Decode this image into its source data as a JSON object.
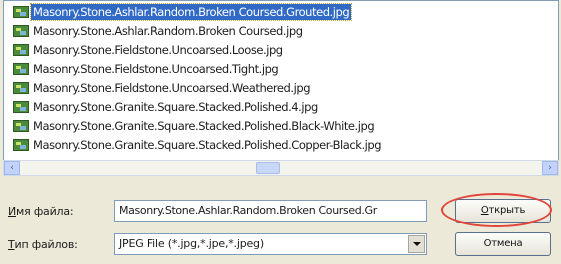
{
  "file_list": {
    "items": [
      {
        "name": "Masonry.Stone.Ashlar.Random.Broken Coursed.Grouted.jpg",
        "selected": true
      },
      {
        "name": "Masonry.Stone.Ashlar.Random.Broken Coursed.jpg",
        "selected": false
      },
      {
        "name": "Masonry.Stone.Fieldstone.Uncoarsed.Loose.jpg",
        "selected": false
      },
      {
        "name": "Masonry.Stone.Fieldstone.Uncoarsed.Tight.jpg",
        "selected": false
      },
      {
        "name": "Masonry.Stone.Fieldstone.Uncoarsed.Weathered.jpg",
        "selected": false
      },
      {
        "name": "Masonry.Stone.Granite.Square.Stacked.Polished.4.jpg",
        "selected": false
      },
      {
        "name": "Masonry.Stone.Granite.Square.Stacked.Polished.Black-White.jpg",
        "selected": false
      },
      {
        "name": "Masonry.Stone.Granite.Square.Stacked.Polished.Copper-Black.jpg",
        "selected": false
      }
    ]
  },
  "scrollbar": {
    "left_arrow": "‹",
    "right_arrow": "›"
  },
  "filename": {
    "label_key": "И",
    "label_rest": "мя файла:",
    "value": "Masonry.Stone.Ashlar.Random.Broken Coursed.Gr"
  },
  "filetype": {
    "label_key": "Т",
    "label_rest": "ип файлов:",
    "value": "JPEG File (*.jpg,*.jpe,*.jpeg)"
  },
  "buttons": {
    "open_key": "О",
    "open_rest": "ткрыть",
    "cancel": "Отмена"
  },
  "colors": {
    "selection": "#316ac5",
    "highlight_ring": "#e0443a",
    "dialog_bg": "#ece9d8"
  }
}
